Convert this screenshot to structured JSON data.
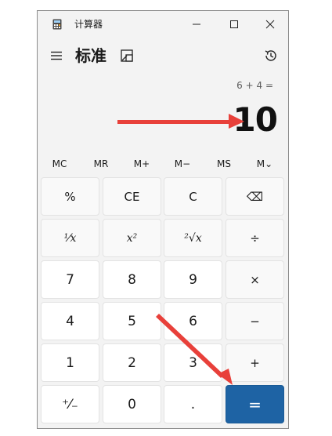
{
  "app": {
    "title": "计算器",
    "mode": "标准"
  },
  "display": {
    "expression": "6 + 4 =",
    "result": "10"
  },
  "memory": [
    "MC",
    "MR",
    "M+",
    "M−",
    "MS",
    "M⌄"
  ],
  "keys": [
    [
      "%",
      "CE",
      "C",
      "⌫"
    ],
    [
      "¹⁄x",
      "x²",
      "²√x",
      "÷"
    ],
    [
      "7",
      "8",
      "9",
      "×"
    ],
    [
      "4",
      "5",
      "6",
      "−"
    ],
    [
      "1",
      "2",
      "3",
      "+"
    ],
    [
      "⁺⁄₋",
      "0",
      ".",
      "="
    ]
  ],
  "colors": {
    "accent": "#1e63a4",
    "annotation_arrow": "#e8403a"
  }
}
